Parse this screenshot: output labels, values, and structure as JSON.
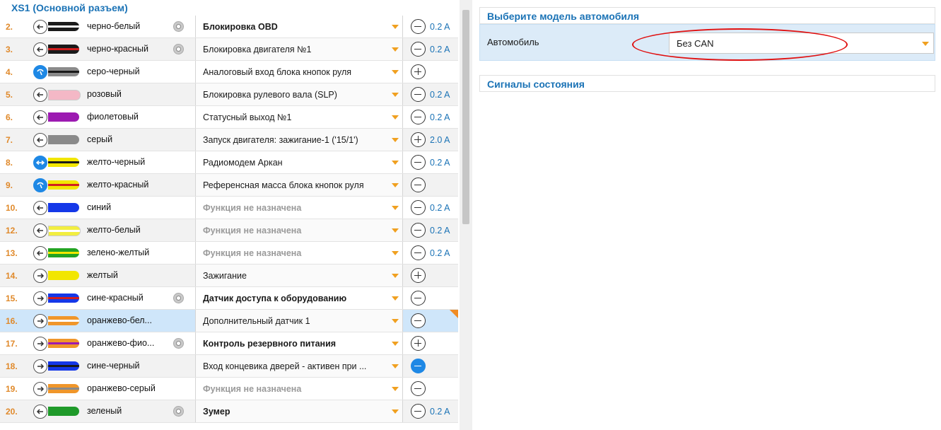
{
  "left_title": "XS1 (Основной разъем)",
  "rows": [
    {
      "num": "2.",
      "wire": "черно-белый",
      "base": "#1a1a1a",
      "stripe": "#ffffff",
      "dir": "out",
      "gear": true,
      "func": "Блокировка OBD",
      "fstyle": "b",
      "pm": "minus",
      "amp": "0.2 A"
    },
    {
      "num": "3.",
      "wire": "черно-красный",
      "base": "#1a1a1a",
      "stripe": "#d11f1f",
      "dir": "out",
      "gear": true,
      "func": "Блокировка двигателя №1",
      "fstyle": "n",
      "pm": "minus",
      "amp": "0.2 A"
    },
    {
      "num": "4.",
      "wire": "серо-черный",
      "base": "#8a8a8a",
      "stripe": "#1a1a1a",
      "dir": "analog",
      "gear": false,
      "func": "Аналоговый вход блока кнопок руля",
      "fstyle": "n",
      "pm": "plus",
      "amp": ""
    },
    {
      "num": "5.",
      "wire": "розовый",
      "base": "#f4b8c6",
      "stripe": "",
      "dir": "out",
      "gear": false,
      "func": "Блокировка рулевого вала (SLP)",
      "fstyle": "n",
      "pm": "minus",
      "amp": "0.2 A"
    },
    {
      "num": "6.",
      "wire": "фиолетовый",
      "base": "#9c1ab1",
      "stripe": "",
      "dir": "out",
      "gear": false,
      "func": "Статусный выход №1",
      "fstyle": "n",
      "pm": "minus",
      "amp": "0.2 A"
    },
    {
      "num": "7.",
      "wire": "серый",
      "base": "#8a8a8a",
      "stripe": "",
      "dir": "out",
      "gear": false,
      "func": "Запуск двигателя: зажигание-1 ('15/1')",
      "fstyle": "n",
      "pm": "plus",
      "amp": "2.0 A"
    },
    {
      "num": "8.",
      "wire": "желто-черный",
      "base": "#f2e600",
      "stripe": "#1a1a1a",
      "dir": "bidir",
      "gear": false,
      "func": "Радиомодем Аркан",
      "fstyle": "n",
      "pm": "minus",
      "amp": "0.2 A"
    },
    {
      "num": "9.",
      "wire": "желто-красный",
      "base": "#f2e600",
      "stripe": "#d11f1f",
      "dir": "analog",
      "gear": false,
      "func": "Референсная масса блока кнопок руля",
      "fstyle": "n",
      "pm": "minus",
      "amp": ""
    },
    {
      "num": "10.",
      "wire": "синий",
      "base": "#1538e8",
      "stripe": "",
      "dir": "out",
      "gear": false,
      "func": "Функция не назначена",
      "fstyle": "g",
      "pm": "minus",
      "amp": "0.2 A"
    },
    {
      "num": "12.",
      "wire": "желто-белый",
      "base": "#f2ee40",
      "stripe": "#ffffff",
      "dir": "out",
      "gear": false,
      "func": "Функция не назначена",
      "fstyle": "g",
      "pm": "minus",
      "amp": "0.2 A"
    },
    {
      "num": "13.",
      "wire": "зелено-желтый",
      "base": "#22a322",
      "stripe": "#f2e600",
      "dir": "out",
      "gear": false,
      "func": "Функция не назначена",
      "fstyle": "g",
      "pm": "minus",
      "amp": "0.2 A"
    },
    {
      "num": "14.",
      "wire": "желтый",
      "base": "#f2e600",
      "stripe": "",
      "dir": "in",
      "gear": false,
      "func": "Зажигание",
      "fstyle": "n",
      "pm": "plus",
      "amp": ""
    },
    {
      "num": "15.",
      "wire": "сине-красный",
      "base": "#1538e8",
      "stripe": "#d11f1f",
      "dir": "in",
      "gear": true,
      "func": "Датчик доступа к оборудованию",
      "fstyle": "b",
      "pm": "minus",
      "amp": ""
    },
    {
      "num": "16.",
      "wire": "оранжево-бел...",
      "base": "#f0962a",
      "stripe": "#ffffff",
      "dir": "in",
      "gear": false,
      "func": "Дополнительный датчик 1",
      "fstyle": "n",
      "pm": "minus",
      "amp": "",
      "selected": true
    },
    {
      "num": "17.",
      "wire": "оранжево-фио...",
      "base": "#f0962a",
      "stripe": "#9c1ab1",
      "dir": "in",
      "gear": true,
      "func": "Контроль резервного питания",
      "fstyle": "b",
      "pm": "plus",
      "amp": ""
    },
    {
      "num": "18.",
      "wire": "сине-черный",
      "base": "#1538e8",
      "stripe": "#1a1a1a",
      "dir": "in",
      "gear": false,
      "func": "Вход концевика дверей - активен при ...",
      "fstyle": "n",
      "pm": "blue",
      "amp": ""
    },
    {
      "num": "19.",
      "wire": "оранжево-серый",
      "base": "#f0962a",
      "stripe": "#8a8a8a",
      "dir": "in",
      "gear": false,
      "func": "Функция не назначена",
      "fstyle": "g",
      "pm": "minus",
      "amp": ""
    },
    {
      "num": "20.",
      "wire": "зеленый",
      "base": "#1f9a2a",
      "stripe": "",
      "dir": "out",
      "gear": true,
      "func": "Зумер",
      "fstyle": "b",
      "pm": "minus",
      "amp": "0.2 A"
    }
  ],
  "car_section": {
    "title": "Выберите модель автомобиля",
    "label": "Автомобиль",
    "value": "Без CAN"
  },
  "signals_section": {
    "title": "Сигналы состояния"
  },
  "colors": {
    "accent": "#1b73b6",
    "number": "#e0892a",
    "caret": "#f0a020",
    "highlight": "#e01010"
  }
}
